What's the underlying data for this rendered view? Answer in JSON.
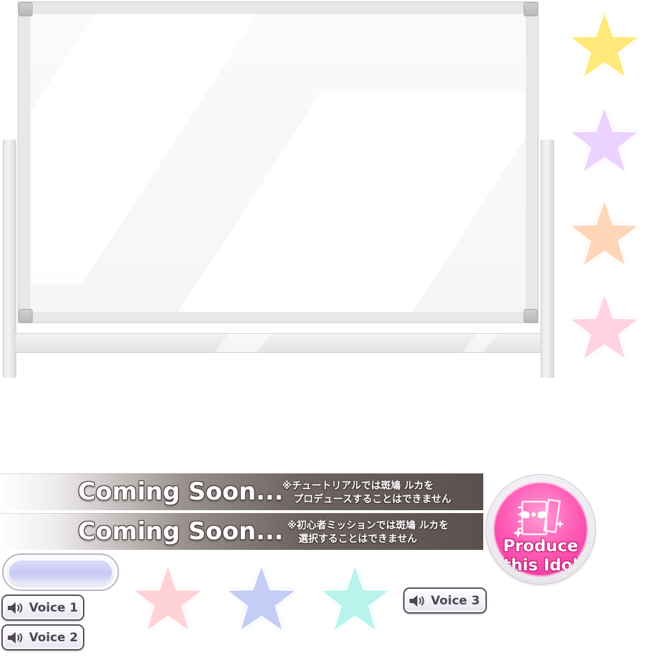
{
  "banners": [
    {
      "title": "Coming Soon...",
      "note_line1": "※チュートリアルでは斑鳩 ルカを",
      "note_line2": "プロデュースすることはできません"
    },
    {
      "title": "Coming Soon...",
      "note_line1": "※初心者ミッションでは斑鳩 ルカを",
      "note_line2": "選択することはできません"
    }
  ],
  "produce_button": {
    "line1": "Produce",
    "line2": "this Idol",
    "icon": "notebook-wings-icon"
  },
  "voice_buttons": [
    {
      "label": "Voice 1",
      "icon": "speaker-icon"
    },
    {
      "label": "Voice 2",
      "icon": "speaker-icon"
    },
    {
      "label": "Voice 3",
      "icon": "speaker-icon"
    }
  ],
  "stars": [
    {
      "name": "star-yellow",
      "color": "#ffe97a"
    },
    {
      "name": "star-purple",
      "color": "#ecd3ff"
    },
    {
      "name": "star-orange",
      "color": "#ffd6b8"
    },
    {
      "name": "star-pink",
      "color": "#ffd3e2"
    },
    {
      "name": "star-pink-bottom",
      "color": "#ffd3d6"
    },
    {
      "name": "star-blue",
      "color": "#c5cdf6"
    },
    {
      "name": "star-cyan",
      "color": "#b8f4ec"
    }
  ],
  "colors": {
    "produce_pink": "#ff5db7",
    "banner_dark": "#5a504e",
    "voice_border": "#5c5162"
  }
}
